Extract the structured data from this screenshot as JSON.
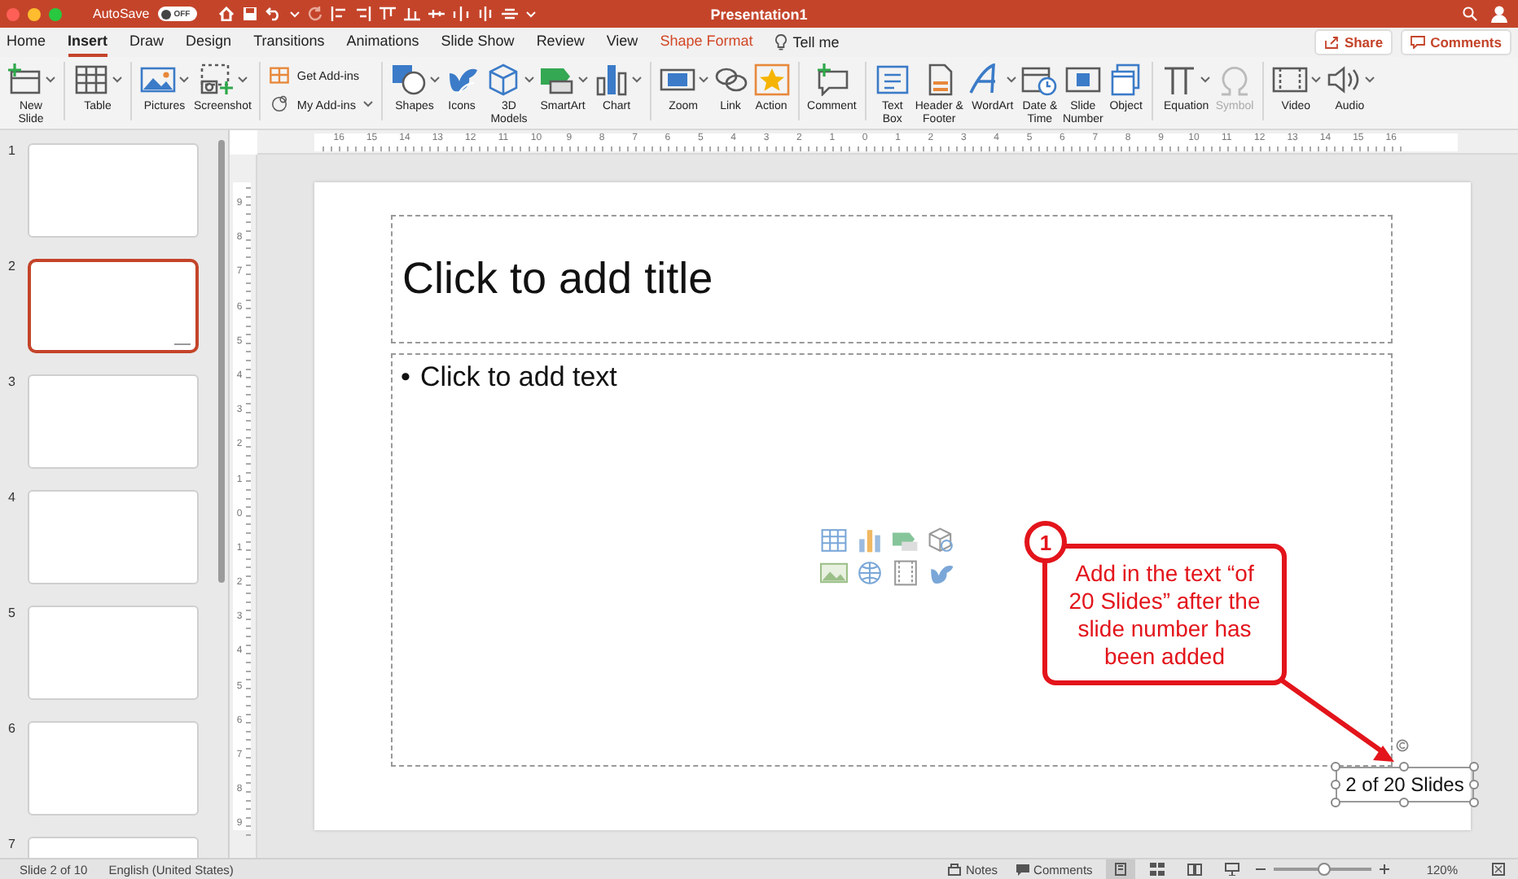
{
  "window": {
    "title": "Presentation1"
  },
  "autosave": {
    "label": "AutoSave",
    "on": false,
    "state": "OFF"
  },
  "tabs": [
    {
      "label": "Home",
      "selected": false,
      "kind": "standard"
    },
    {
      "label": "Insert",
      "selected": true,
      "kind": "standard"
    },
    {
      "label": "Draw",
      "selected": false,
      "kind": "standard"
    },
    {
      "label": "Design",
      "selected": false,
      "kind": "standard"
    },
    {
      "label": "Transitions",
      "selected": false,
      "kind": "standard"
    },
    {
      "label": "Animations",
      "selected": false,
      "kind": "standard"
    },
    {
      "label": "Slide Show",
      "selected": false,
      "kind": "standard"
    },
    {
      "label": "Review",
      "selected": false,
      "kind": "standard"
    },
    {
      "label": "View",
      "selected": false,
      "kind": "standard"
    },
    {
      "label": "Shape Format",
      "selected": false,
      "kind": "contextual"
    }
  ],
  "tell_me": "Tell me",
  "share": "Share",
  "comments_button": "Comments",
  "ribbon": [
    {
      "kind": "large",
      "buttons": [
        {
          "label": "New\nSlide",
          "dropdown": true,
          "disabled": false
        }
      ]
    },
    {
      "kind": "large",
      "buttons": [
        {
          "label": "Table",
          "dropdown": true,
          "disabled": false
        }
      ]
    },
    {
      "kind": "large",
      "buttons": [
        {
          "label": "Pictures",
          "dropdown": true,
          "disabled": false
        },
        {
          "label": "Screenshot",
          "dropdown": true,
          "disabled": false
        }
      ]
    },
    {
      "kind": "stacked",
      "buttons": [
        {
          "label": "Get Add-ins",
          "dropdown": false,
          "disabled": false
        },
        {
          "label": "My Add-ins",
          "dropdown": true,
          "disabled": false
        }
      ]
    },
    {
      "kind": "large",
      "buttons": [
        {
          "label": "Shapes",
          "dropdown": true,
          "disabled": false
        },
        {
          "label": "Icons",
          "dropdown": false,
          "disabled": false
        },
        {
          "label": "3D\nModels",
          "dropdown": true,
          "disabled": false
        },
        {
          "label": "SmartArt",
          "dropdown": true,
          "disabled": false
        },
        {
          "label": "Chart",
          "dropdown": true,
          "disabled": false
        }
      ]
    },
    {
      "kind": "large",
      "buttons": [
        {
          "label": "Zoom",
          "dropdown": true,
          "disabled": false
        },
        {
          "label": "Link",
          "dropdown": false,
          "disabled": false
        },
        {
          "label": "Action",
          "dropdown": false,
          "disabled": false
        }
      ]
    },
    {
      "kind": "large",
      "buttons": [
        {
          "label": "Comment",
          "dropdown": false,
          "disabled": false
        }
      ]
    },
    {
      "kind": "large",
      "buttons": [
        {
          "label": "Text\nBox",
          "dropdown": false,
          "disabled": false
        },
        {
          "label": "Header &\nFooter",
          "dropdown": false,
          "disabled": false
        },
        {
          "label": "WordArt",
          "dropdown": true,
          "disabled": false
        },
        {
          "label": "Date &\nTime",
          "dropdown": false,
          "disabled": false
        },
        {
          "label": "Slide\nNumber",
          "dropdown": false,
          "disabled": false
        },
        {
          "label": "Object",
          "dropdown": false,
          "disabled": false
        }
      ]
    },
    {
      "kind": "large",
      "buttons": [
        {
          "label": "Equation",
          "dropdown": true,
          "disabled": false
        },
        {
          "label": "Symbol",
          "dropdown": false,
          "disabled": true
        }
      ]
    },
    {
      "kind": "large",
      "buttons": [
        {
          "label": "Video",
          "dropdown": true,
          "disabled": false
        },
        {
          "label": "Audio",
          "dropdown": true,
          "disabled": false
        }
      ]
    }
  ],
  "ruler": {
    "horizontal": [
      "16",
      "15",
      "14",
      "13",
      "12",
      "11",
      "10",
      "9",
      "8",
      "7",
      "6",
      "5",
      "4",
      "3",
      "2",
      "1",
      "0",
      "1",
      "2",
      "3",
      "4",
      "5",
      "6",
      "7",
      "8",
      "9",
      "10",
      "11",
      "12",
      "13",
      "14",
      "15",
      "16"
    ],
    "vertical": [
      "9",
      "8",
      "7",
      "6",
      "5",
      "4",
      "3",
      "2",
      "1",
      "0",
      "1",
      "2",
      "3",
      "4",
      "5",
      "6",
      "7",
      "8",
      "9"
    ]
  },
  "slides": [
    {
      "number": "1",
      "selected": false
    },
    {
      "number": "2",
      "selected": true
    },
    {
      "number": "3",
      "selected": false
    },
    {
      "number": "4",
      "selected": false
    },
    {
      "number": "5",
      "selected": false
    },
    {
      "number": "6",
      "selected": false
    },
    {
      "number": "7",
      "selected": false
    }
  ],
  "slide": {
    "title_placeholder": "Click to add title",
    "bullet": "•",
    "body_placeholder": "Click to add text",
    "footer_text": "2 of 20 Slides"
  },
  "callout": {
    "number": "1",
    "text": "Add in the text “of 20 Slides” after the slide number has been added"
  },
  "status_bar": {
    "slide": "Slide 2 of 10",
    "language": "English (United States)",
    "notes": "Notes",
    "comments": "Comments",
    "views": [
      {
        "selected": true
      },
      {
        "selected": false
      },
      {
        "selected": false
      },
      {
        "selected": false
      }
    ],
    "zoom": {
      "level": 0.52,
      "reading": "120%"
    }
  }
}
